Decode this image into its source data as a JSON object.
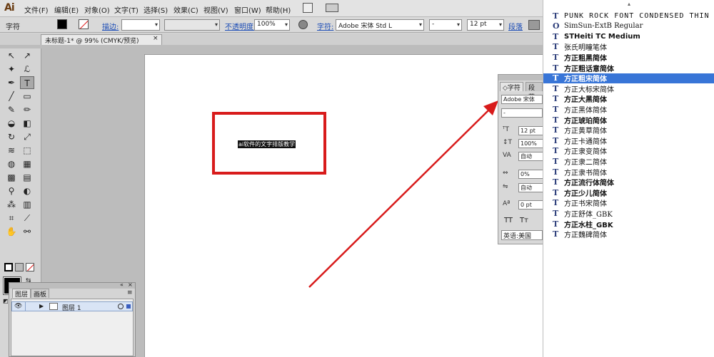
{
  "app": {
    "logo": "Ai"
  },
  "menu": [
    "文件(F)",
    "编辑(E)",
    "对象(O)",
    "文字(T)",
    "选择(S)",
    "效果(C)",
    "视图(V)",
    "窗口(W)",
    "帮助(H)"
  ],
  "control_bar": {
    "left_label": "字符",
    "stroke_link": "描边:",
    "opacity_link": "不透明度:",
    "opacity_value": "100%",
    "char_link": "字符:",
    "font_family": "Adobe 宋体 Std L",
    "font_style": "-",
    "font_size": "12 pt",
    "para_link": "段落"
  },
  "document": {
    "tab_title": "未标题-1* @ 99% (CMYK/预览)",
    "close": "×"
  },
  "canvas": {
    "selected_text": "ai软件的文字排版教学",
    "frame_color": "#d81b1b",
    "arrow_color": "#d81b1b"
  },
  "char_panel": {
    "tabs": [
      "◇字符",
      "段落"
    ],
    "font_family": "Adobe 宋体",
    "font_style": "-",
    "size": "12 pt",
    "leading": "100%",
    "kerning": "自动",
    "tracking": "0%",
    "auto": "自动",
    "baseline": "0 pt",
    "tt1": "TT",
    "tt2": "Tт",
    "language": "英语:美国"
  },
  "font_list": [
    {
      "name": "PUNK ROCK FONT CONDENSED THIN",
      "icon": "T"
    },
    {
      "name": "SimSun-ExtB Regular",
      "icon": "O"
    },
    {
      "name": "STHeiti TC Medium",
      "icon": "T"
    },
    {
      "name": "张氏明瞳笔体",
      "icon": "T"
    },
    {
      "name": "方正粗黑简体",
      "icon": "T"
    },
    {
      "name": "方正粗话意简体",
      "icon": "T"
    },
    {
      "name": "方正粗宋简体",
      "icon": "T"
    },
    {
      "name": "方正大标宋简体",
      "icon": "T"
    },
    {
      "name": "方正大黑简体",
      "icon": "T"
    },
    {
      "name": "方正黑体简体",
      "icon": "T"
    },
    {
      "name": "方正琥珀简体",
      "icon": "T"
    },
    {
      "name": "方正黄草简体",
      "icon": "T"
    },
    {
      "name": "方正卡通简体",
      "icon": "T"
    },
    {
      "name": "方正隶变简体",
      "icon": "T"
    },
    {
      "name": "方正隶二简体",
      "icon": "T"
    },
    {
      "name": "方正隶书简体",
      "icon": "T"
    },
    {
      "name": "方正流行体简体",
      "icon": "T"
    },
    {
      "name": "方正少儿简体",
      "icon": "T"
    },
    {
      "name": "方正书宋简体",
      "icon": "T"
    },
    {
      "name": "方正舒体_GBK",
      "icon": "T"
    },
    {
      "name": "方正水柱_GBK",
      "icon": "T"
    },
    {
      "name": "方正魏碑简体",
      "icon": "T"
    }
  ],
  "font_list_selected": 6,
  "layers": {
    "tabs": [
      "图层",
      "画板"
    ],
    "layer_name": "图层 1"
  }
}
